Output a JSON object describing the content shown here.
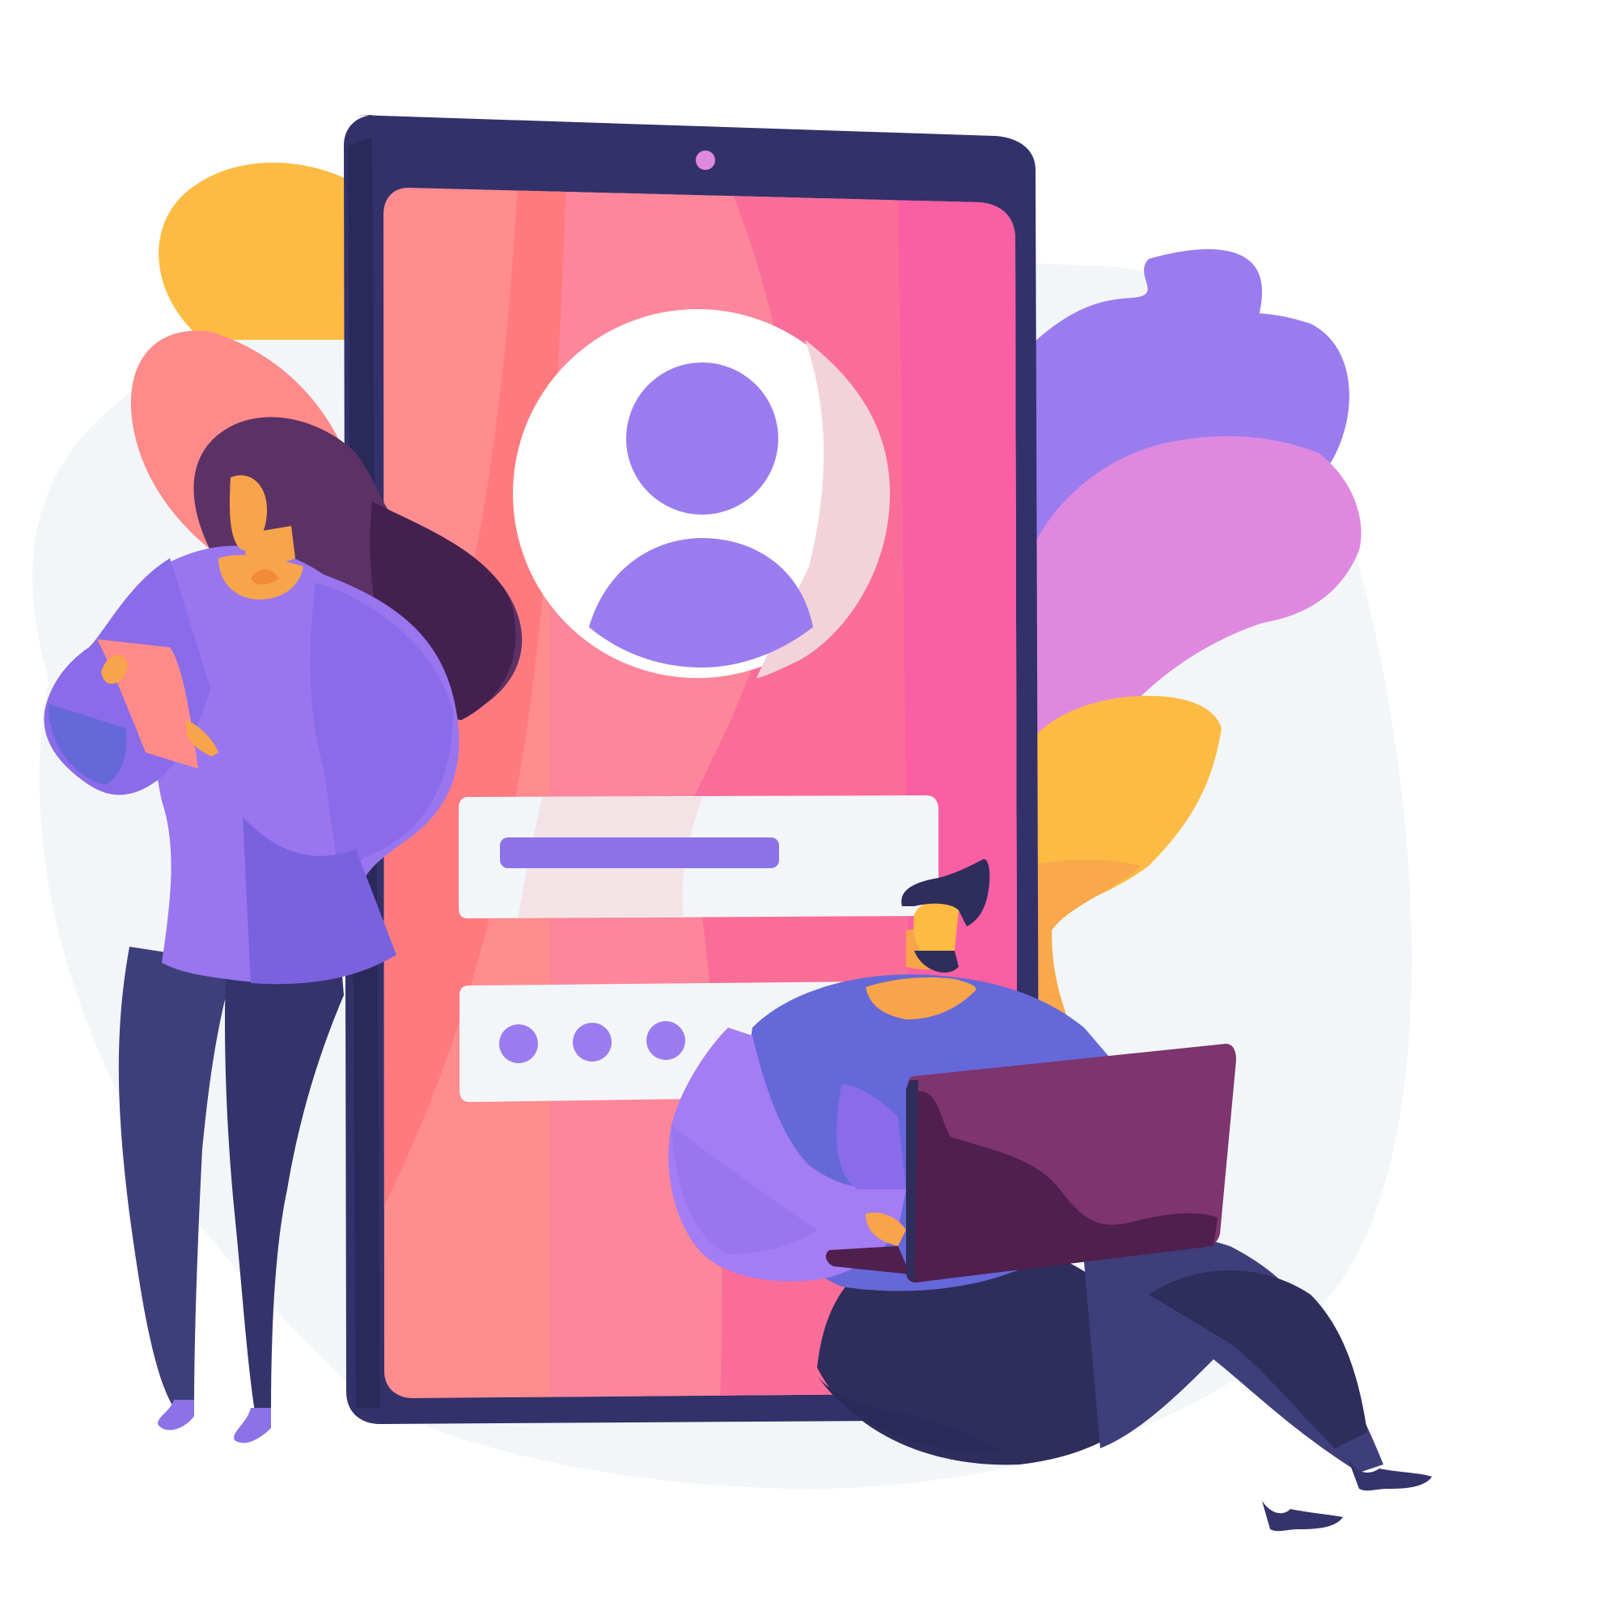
{
  "illustration": {
    "subject": "",
    "palette": {
      "background_blob": "#f3f6f9",
      "phone_body": "#2f2d5c",
      "screen_coral": "#ff8c8f",
      "screen_pink": "#fd7fa0",
      "screen_magenta": "#fb5f9f",
      "avatar_circle": "#ffffff",
      "avatar_purple": "#9b7cef",
      "field_light": "#f3f6f9",
      "field_bar": "#8b72e8",
      "leaf_yellow": "#fdbb43",
      "leaf_orange": "#f9a94b",
      "leaf_salmon": "#fe8b8a",
      "leaf_violet": "#9a7cef",
      "leaf_orchid": "#de89df",
      "skin": "#f8a44a",
      "hair_dark": "#5c3266",
      "shirt_purple": "#9a75f0",
      "pants_navy": "#34336b",
      "laptop_plum": "#7e346e",
      "laptop_dark": "#4f1f4e",
      "man_shirt_blue": "#6568d8"
    },
    "form": {
      "username_field": "empty",
      "password_dots_count": 3
    },
    "icons": [
      "user-avatar-icon"
    ]
  }
}
